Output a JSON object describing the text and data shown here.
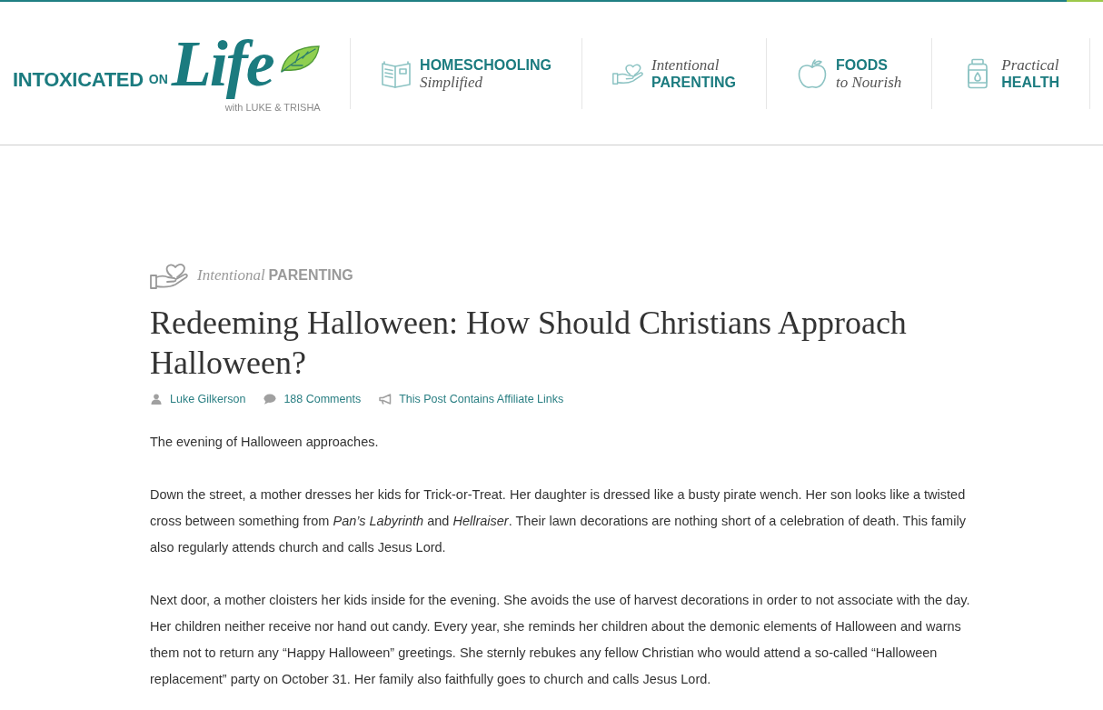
{
  "header": {
    "logo": {
      "wordmark": "INTOXICATED",
      "connector": "ON",
      "script": "Life",
      "tagline": "with LUKE & TRISHA"
    },
    "nav": [
      {
        "lines": [
          {
            "kind": "caps",
            "text": "HOMESCHOOLING"
          },
          {
            "kind": "script",
            "text": "Simplified"
          }
        ]
      },
      {
        "lines": [
          {
            "kind": "script",
            "text": "Intentional"
          },
          {
            "kind": "caps",
            "text": "PARENTING"
          }
        ]
      },
      {
        "lines": [
          {
            "kind": "caps",
            "text": "FOODS"
          },
          {
            "kind": "script",
            "text": "to Nourish"
          }
        ]
      },
      {
        "lines": [
          {
            "kind": "script",
            "text": "Practical"
          },
          {
            "kind": "caps",
            "text": "HEALTH"
          }
        ]
      }
    ]
  },
  "article": {
    "category": {
      "parts": [
        {
          "kind": "script",
          "text": "Intentional"
        },
        {
          "kind": "caps",
          "text": "PARENTING"
        }
      ]
    },
    "title": "Redeeming Halloween: How Should Christians Approach Halloween?",
    "meta": [
      {
        "kind": "author",
        "text": "Luke Gilkerson"
      },
      {
        "kind": "comments",
        "text": "188 Comments"
      },
      {
        "kind": "disclosure",
        "text": "This Post Contains Affiliate Links"
      }
    ],
    "paragraphs": [
      "The evening of Halloween approaches.",
      "Down the street, a mother dresses her kids for Trick-or-Treat. Her daughter is dressed like a busty pirate wench. Her son looks like a twisted cross between something from *Pan’s Labyrinth* and *Hellraiser*. Their lawn decorations are nothing short of a celebration of death. This family also regularly attends church and calls Jesus Lord.",
      "Next door, a mother cloisters her kids inside for the evening. She avoids the use of harvest decorations in order to not associate with the day. Her children neither receive nor hand out candy. Every year, she reminds her children about the demonic elements of Halloween and warns them not to return any “Happy Halloween” greetings. She sternly rebukes any fellow Christian who would attend a so-called “Halloween replacement” party on October 31. Her family also faithfully goes to church and calls Jesus Lord."
    ]
  }
}
